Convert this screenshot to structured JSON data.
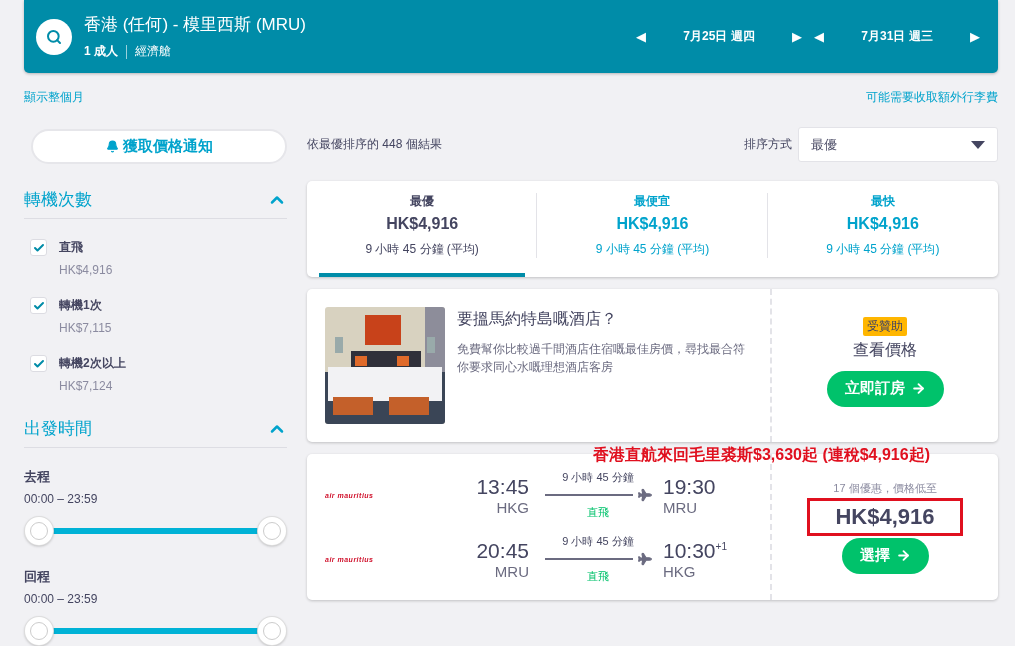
{
  "search": {
    "route": "香港 (任何) - 模里西斯 (MRU)",
    "passengers": "1 成人",
    "cabin": "經濟艙",
    "dates": [
      {
        "label": "7月25日 週四",
        "prev": "◀",
        "next": "▶"
      },
      {
        "label": "7月31日 週三",
        "prev": "◀",
        "next": "▶"
      }
    ]
  },
  "links": {
    "month": "顯示整個月",
    "fees": "可能需要收取額外行李費"
  },
  "alert_button": "獲取價格通知",
  "filters": [
    {
      "title": "轉機次數",
      "expanded": true,
      "kind": "checks",
      "options": [
        {
          "label": "直飛",
          "price": "HK$4,916",
          "checked": true
        },
        {
          "label": "轉機1次",
          "price": "HK$7,115",
          "checked": true
        },
        {
          "label": "轉機2次以上",
          "price": "HK$7,124",
          "checked": true
        }
      ]
    },
    {
      "title": "出發時間",
      "expanded": true,
      "kind": "sliders",
      "sliders": [
        {
          "label": "去程",
          "range": "00:00 – 23:59",
          "thumbs": [
            {
              "level": 0
            },
            {
              "level": 1
            }
          ]
        },
        {
          "label": "回程",
          "range": "00:00 – 23:59",
          "thumbs": [
            {
              "level": 0
            },
            {
              "level": 1
            }
          ]
        }
      ]
    }
  ],
  "results": {
    "summary": "依最優排序的 448 個結果",
    "sort_label": "排序方式",
    "sort_value": "最優"
  },
  "tabs": [
    {
      "label": "最優",
      "price": "HK$4,916",
      "duration": "9 小時 45 分鐘 (平均)",
      "selected": true
    },
    {
      "label": "最便宜",
      "price": "HK$4,916",
      "duration": "9 小時 45 分鐘 (平均)",
      "selected": false
    },
    {
      "label": "最快",
      "price": "HK$4,916",
      "duration": "9 小時 45 分鐘 (平均)",
      "selected": false
    }
  ],
  "hotel_ad": {
    "kind": "picture",
    "title": "要搵馬約特島嘅酒店？",
    "text": "免費幫你比較過千間酒店住宿嘅最佳房價，尋找最合符你要求同心水嘅理想酒店客房",
    "badge": "受贊助",
    "subtitle": "查看價格",
    "button": "立即訂房"
  },
  "annotation": "香港直航來回毛里裘斯$3,630起 (連稅$4,916起)",
  "flight": {
    "legs": [
      {
        "airline": "air mauritius",
        "depart": "13:45",
        "from": "HKG",
        "duration": "9 小時 45 分鐘",
        "stops": "直飛",
        "arrive": "19:30",
        "to": "MRU"
      },
      {
        "airline": "air mauritius",
        "depart": "20:45",
        "from": "MRU",
        "duration": "9 小時 45 分鐘",
        "stops": "直飛",
        "arrive": "10:30",
        "day_offset": "+1",
        "to": "HKG"
      }
    ],
    "deals": "17 個優惠，價格低至",
    "price": "HK$4,916",
    "highlighted": true,
    "button": "選擇"
  }
}
